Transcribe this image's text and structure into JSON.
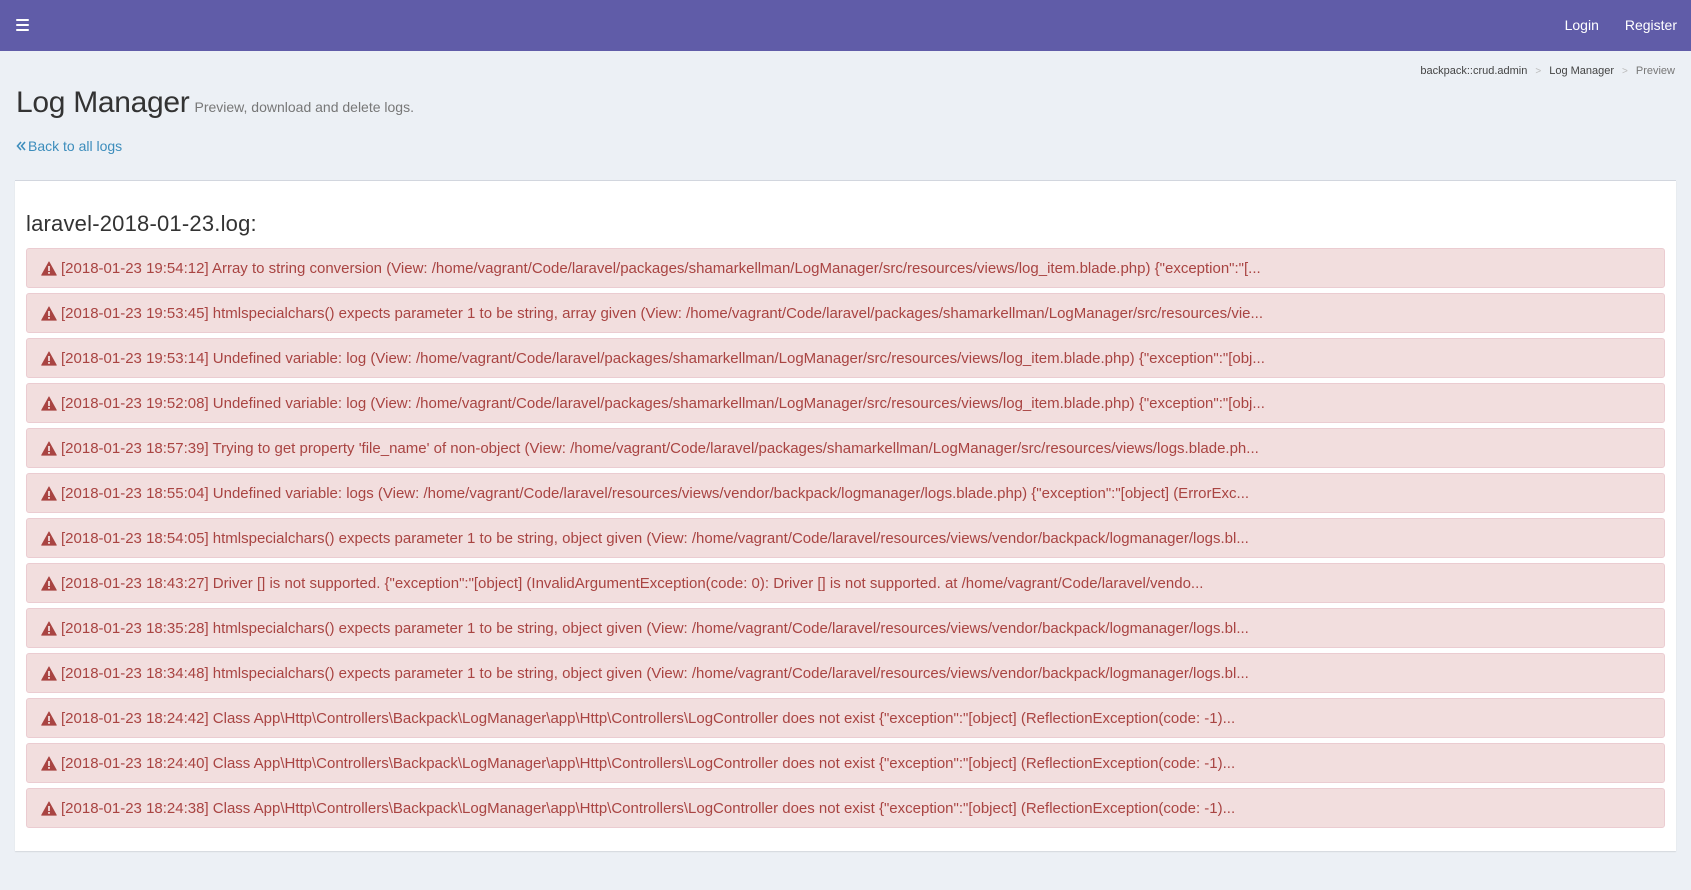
{
  "topbar": {
    "menu_icon": "hamburger-icon",
    "login_label": "Login",
    "register_label": "Register",
    "background_color": "#605ca8"
  },
  "breadcrumb": {
    "items": [
      "backpack::crud.admin",
      "Log Manager",
      "Preview"
    ],
    "separator": ">"
  },
  "header": {
    "title": "Log Manager",
    "subtitle": "Preview, download and delete logs."
  },
  "back_link": {
    "icon": "double-chevron-left-icon",
    "label": "Back to all logs",
    "color": "#3c8dbc"
  },
  "log_file": {
    "title": "laravel-2018-01-23.log:",
    "entry_color": "#a94442",
    "entry_background": "#f2dede",
    "entry_icon": "warning-icon",
    "entries": [
      "[2018-01-23 19:54:12] Array to string conversion (View: /home/vagrant/Code/laravel/packages/shamarkellman/LogManager/src/resources/views/log_item.blade.php) {\"exception\":\"[...",
      "[2018-01-23 19:53:45] htmlspecialchars() expects parameter 1 to be string, array given (View: /home/vagrant/Code/laravel/packages/shamarkellman/LogManager/src/resources/vie...",
      "[2018-01-23 19:53:14] Undefined variable: log (View: /home/vagrant/Code/laravel/packages/shamarkellman/LogManager/src/resources/views/log_item.blade.php) {\"exception\":\"[obj...",
      "[2018-01-23 19:52:08] Undefined variable: log (View: /home/vagrant/Code/laravel/packages/shamarkellman/LogManager/src/resources/views/log_item.blade.php) {\"exception\":\"[obj...",
      "[2018-01-23 18:57:39] Trying to get property 'file_name' of non-object (View: /home/vagrant/Code/laravel/packages/shamarkellman/LogManager/src/resources/views/logs.blade.ph...",
      "[2018-01-23 18:55:04] Undefined variable: logs (View: /home/vagrant/Code/laravel/resources/views/vendor/backpack/logmanager/logs.blade.php) {\"exception\":\"[object] (ErrorExc...",
      "[2018-01-23 18:54:05] htmlspecialchars() expects parameter 1 to be string, object given (View: /home/vagrant/Code/laravel/resources/views/vendor/backpack/logmanager/logs.bl...",
      "[2018-01-23 18:43:27] Driver [] is not supported. {\"exception\":\"[object] (InvalidArgumentException(code: 0): Driver [] is not supported. at /home/vagrant/Code/laravel/vendo...",
      "[2018-01-23 18:35:28] htmlspecialchars() expects parameter 1 to be string, object given (View: /home/vagrant/Code/laravel/resources/views/vendor/backpack/logmanager/logs.bl...",
      "[2018-01-23 18:34:48] htmlspecialchars() expects parameter 1 to be string, object given (View: /home/vagrant/Code/laravel/resources/views/vendor/backpack/logmanager/logs.bl...",
      "[2018-01-23 18:24:42] Class App\\Http\\Controllers\\Backpack\\LogManager\\app\\Http\\Controllers\\LogController does not exist {\"exception\":\"[object] (ReflectionException(code: -1)...",
      "[2018-01-23 18:24:40] Class App\\Http\\Controllers\\Backpack\\LogManager\\app\\Http\\Controllers\\LogController does not exist {\"exception\":\"[object] (ReflectionException(code: -1)...",
      "[2018-01-23 18:24:38] Class App\\Http\\Controllers\\Backpack\\LogManager\\app\\Http\\Controllers\\LogController does not exist {\"exception\":\"[object] (ReflectionException(code: -1)..."
    ]
  }
}
